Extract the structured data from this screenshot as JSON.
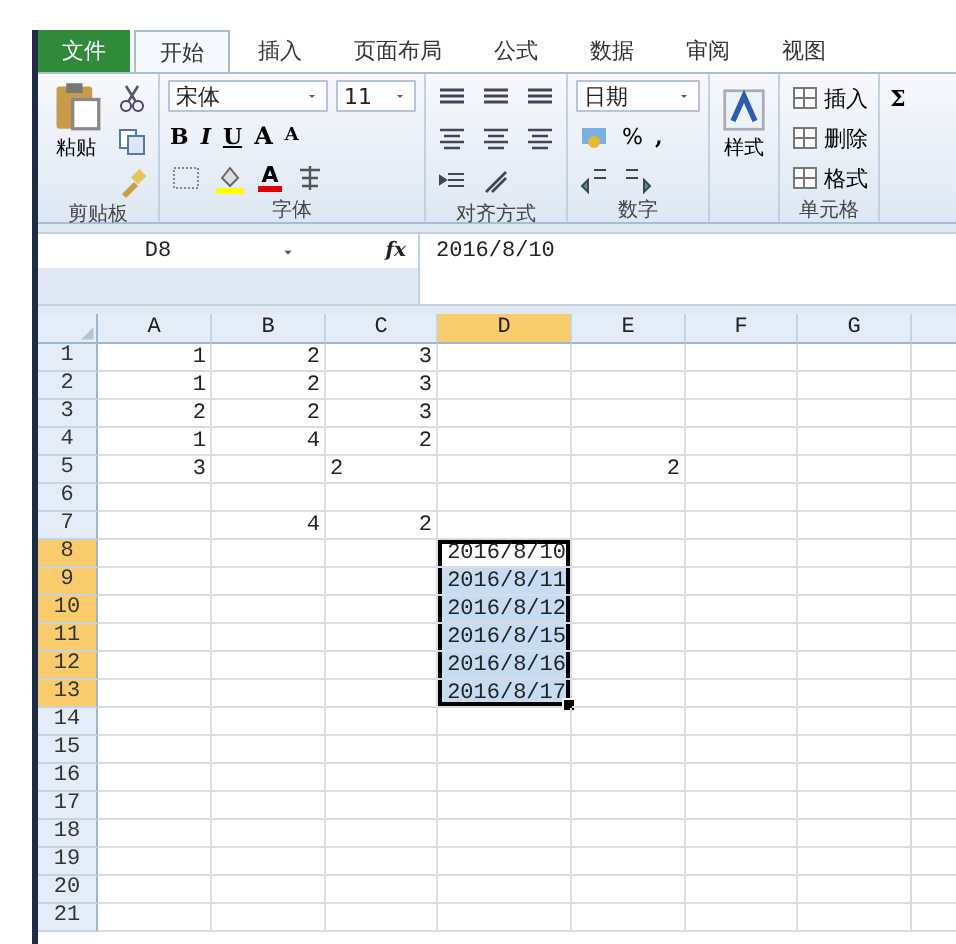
{
  "tabs": [
    {
      "label": "文件",
      "kind": "file",
      "selected": false
    },
    {
      "label": "开始",
      "kind": "tab",
      "selected": true
    },
    {
      "label": "插入",
      "kind": "tab",
      "selected": false
    },
    {
      "label": "页面布局",
      "kind": "tab",
      "selected": false
    },
    {
      "label": "公式",
      "kind": "tab",
      "selected": false
    },
    {
      "label": "数据",
      "kind": "tab",
      "selected": false
    },
    {
      "label": "审阅",
      "kind": "tab",
      "selected": false
    },
    {
      "label": "视图",
      "kind": "tab",
      "selected": false
    }
  ],
  "ribbon": {
    "clipboard": {
      "paste": "粘贴",
      "label": "剪贴板"
    },
    "font": {
      "name": "宋体",
      "size": "11",
      "bold": "B",
      "italic": "I",
      "underline": "U",
      "grow": "A",
      "shrink": "A",
      "font_color_button": "A",
      "label": "字体"
    },
    "alignment": {
      "label": "对齐方式"
    },
    "number": {
      "format": "日期",
      "percent": "%",
      "comma": ",",
      "label": "数字"
    },
    "styles": {
      "button": "样式"
    },
    "cells": {
      "items": [
        "插入",
        "删除",
        "格式"
      ],
      "label": "单元格"
    },
    "editing": {
      "sum": "Σ"
    }
  },
  "formula_bar": {
    "name_box": "D8",
    "fx": "fx",
    "value": "2016/8/10"
  },
  "sheet": {
    "columns": [
      {
        "label": "A",
        "selected": false
      },
      {
        "label": "B",
        "selected": false
      },
      {
        "label": "C",
        "selected": false
      },
      {
        "label": "D",
        "selected": true
      },
      {
        "label": "E",
        "selected": false
      },
      {
        "label": "F",
        "selected": false
      },
      {
        "label": "G",
        "selected": false
      }
    ],
    "rows": [
      {
        "number": "1",
        "selected": false,
        "cells": [
          {
            "value": "1",
            "kind": "number"
          },
          {
            "value": "2",
            "kind": "number"
          },
          {
            "value": "3",
            "kind": "number"
          },
          null,
          null,
          null,
          null
        ]
      },
      {
        "number": "2",
        "selected": false,
        "cells": [
          {
            "value": "1",
            "kind": "number"
          },
          {
            "value": "2",
            "kind": "number"
          },
          {
            "value": "3",
            "kind": "number"
          },
          null,
          null,
          null,
          null
        ]
      },
      {
        "number": "3",
        "selected": false,
        "cells": [
          {
            "value": "2",
            "kind": "number"
          },
          {
            "value": "2",
            "kind": "number"
          },
          {
            "value": "3",
            "kind": "number"
          },
          null,
          null,
          null,
          null
        ]
      },
      {
        "number": "4",
        "selected": false,
        "cells": [
          {
            "value": "1",
            "kind": "number"
          },
          {
            "value": "4",
            "kind": "number"
          },
          {
            "value": "2",
            "kind": "number"
          },
          null,
          null,
          null,
          null
        ]
      },
      {
        "number": "5",
        "selected": false,
        "cells": [
          {
            "value": "3",
            "kind": "number"
          },
          null,
          {
            "value": "2",
            "kind": "text"
          },
          null,
          {
            "value": "2",
            "kind": "number"
          },
          null,
          null
        ]
      },
      {
        "number": "6",
        "selected": false
      },
      {
        "number": "7",
        "selected": false,
        "cells": [
          null,
          {
            "value": "4",
            "kind": "number"
          },
          {
            "value": "2",
            "kind": "number"
          },
          null,
          null,
          null,
          null
        ]
      },
      {
        "number": "8",
        "selected": true,
        "cells": [
          null,
          null,
          null,
          {
            "value": "2016/8/10",
            "kind": "number",
            "selected": true,
            "active": true
          },
          null,
          null,
          null
        ]
      },
      {
        "number": "9",
        "selected": true,
        "cells": [
          null,
          null,
          null,
          {
            "value": "2016/8/11",
            "kind": "number",
            "selected": true,
            "active": false
          },
          null,
          null,
          null
        ]
      },
      {
        "number": "10",
        "selected": true,
        "cells": [
          null,
          null,
          null,
          {
            "value": "2016/8/12",
            "kind": "number",
            "selected": true,
            "active": false
          },
          null,
          null,
          null
        ]
      },
      {
        "number": "11",
        "selected": true,
        "cells": [
          null,
          null,
          null,
          {
            "value": "2016/8/15",
            "kind": "number",
            "selected": true,
            "active": false
          },
          null,
          null,
          null
        ]
      },
      {
        "number": "12",
        "selected": true,
        "cells": [
          null,
          null,
          null,
          {
            "value": "2016/8/16",
            "kind": "number",
            "selected": true,
            "active": false
          },
          null,
          null,
          null
        ]
      },
      {
        "number": "13",
        "selected": true,
        "cells": [
          null,
          null,
          null,
          {
            "value": "2016/8/17",
            "kind": "number",
            "selected": true,
            "active": false
          },
          null,
          null,
          null
        ]
      },
      {
        "number": "14",
        "selected": false
      },
      {
        "number": "15",
        "selected": false
      },
      {
        "number": "16",
        "selected": false
      },
      {
        "number": "17",
        "selected": false
      },
      {
        "number": "18",
        "selected": false
      },
      {
        "number": "19",
        "selected": false
      },
      {
        "number": "20",
        "selected": false
      },
      {
        "number": "21",
        "selected": false
      }
    ]
  }
}
